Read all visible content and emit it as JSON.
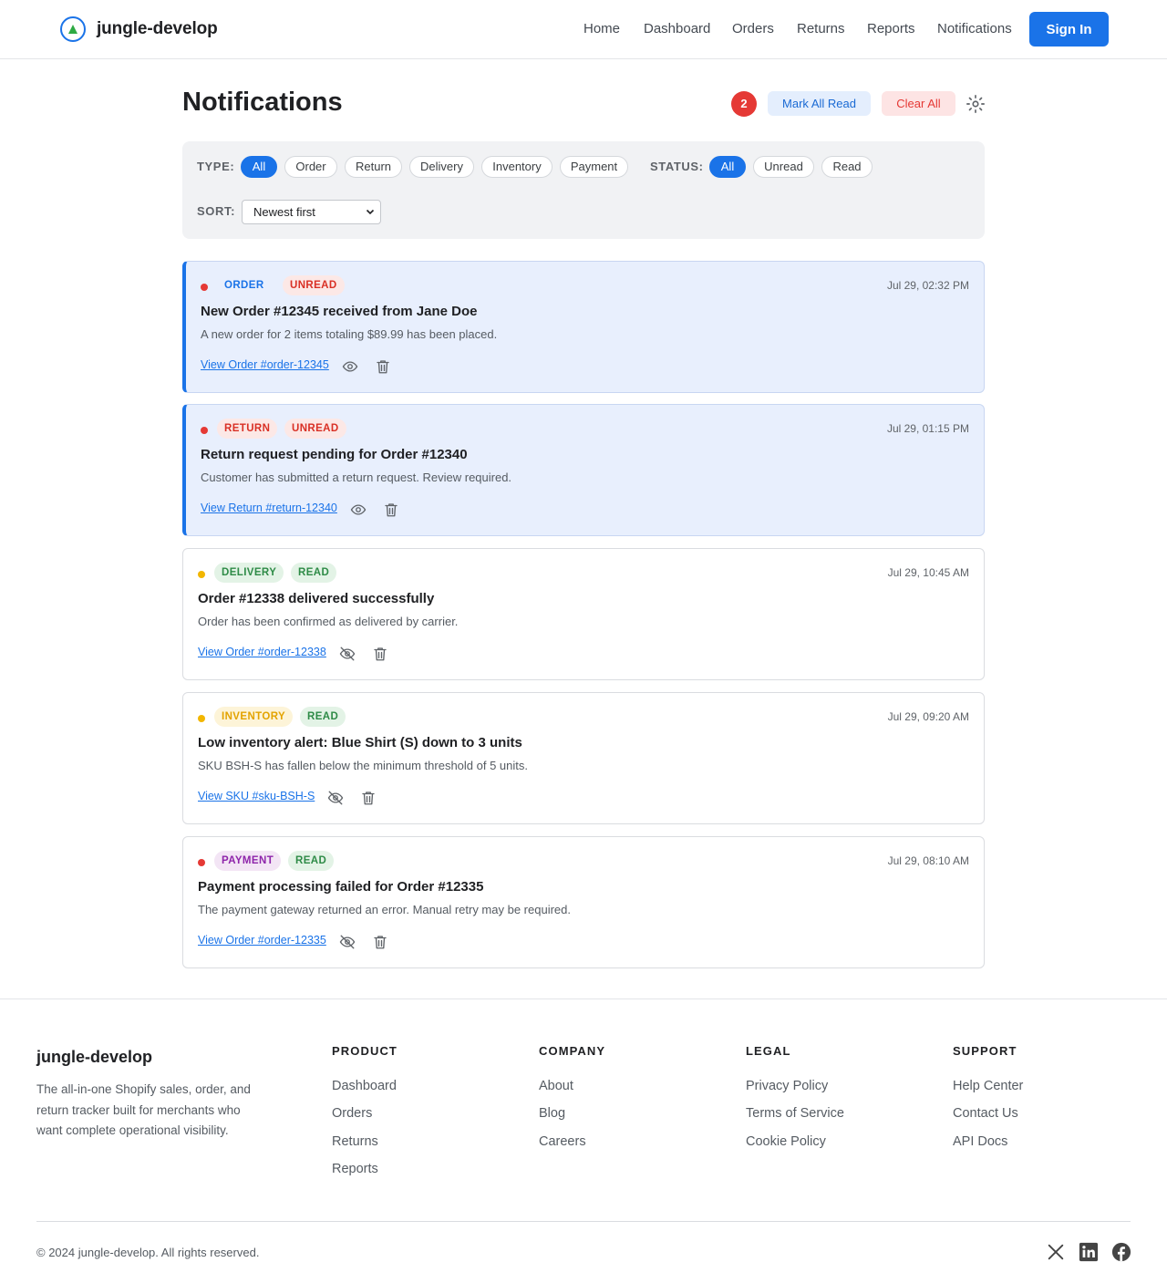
{
  "header": {
    "brand": "jungle-develop",
    "nav": [
      "Home",
      "Dashboard",
      "Orders",
      "Returns",
      "Reports",
      "Notifications"
    ],
    "signin_label": "Sign In"
  },
  "page": {
    "title": "Notifications",
    "unread_count": "2",
    "mark_all_label": "Mark All Read",
    "clear_all_label": "Clear All"
  },
  "filters": {
    "type_label": "TYPE:",
    "type_options": [
      "All",
      "Order",
      "Return",
      "Delivery",
      "Inventory",
      "Payment"
    ],
    "type_selected": "All",
    "status_label": "STATUS:",
    "status_options": [
      "All",
      "Unread",
      "Read"
    ],
    "status_selected": "All",
    "sort_label": "SORT:",
    "sort_value": "Newest first"
  },
  "notifications": [
    {
      "type": "ORDER",
      "status": "UNREAD",
      "time": "Jul 29, 02:32 PM",
      "title": "New Order #12345 received from Jane Doe",
      "description": "A new order for 2 items totaling $89.99 has been placed.",
      "link": "View Order #order-12345",
      "dot_color": "#e53935",
      "type_color": "#1a73e8",
      "type_bg": "transparent"
    },
    {
      "type": "RETURN",
      "status": "UNREAD",
      "time": "Jul 29, 01:15 PM",
      "title": "Return request pending for Order #12340",
      "description": "Customer has submitted a return request. Review required.",
      "link": "View Return #return-12340",
      "dot_color": "#e53935",
      "type_color": "#d93025",
      "type_bg": "#fce8e6"
    },
    {
      "type": "DELIVERY",
      "status": "READ",
      "time": "Jul 29, 10:45 AM",
      "title": "Order #12338 delivered successfully",
      "description": "Order has been confirmed as delivered by carrier.",
      "link": "View Order #order-12338",
      "dot_color": "#f2b600",
      "type_color": "#2e8b47",
      "type_bg": "#e3f3e6"
    },
    {
      "type": "INVENTORY",
      "status": "READ",
      "time": "Jul 29, 09:20 AM",
      "title": "Low inventory alert: Blue Shirt (S) down to 3 units",
      "description": "SKU BSH-S has fallen below the minimum threshold of 5 units.",
      "link": "View SKU #sku-BSH-S",
      "dot_color": "#f2b600",
      "type_color": "#e3a300",
      "type_bg": "#fdf4d8"
    },
    {
      "type": "PAYMENT",
      "status": "READ",
      "time": "Jul 29, 08:10 AM",
      "title": "Payment processing failed for Order #12335",
      "description": "The payment gateway returned an error. Manual retry may be required.",
      "link": "View Order #order-12335",
      "dot_color": "#e53935",
      "type_color": "#8e24aa",
      "type_bg": "#f3e5f5"
    }
  ],
  "footer": {
    "brand": "jungle-develop",
    "description": "The all-in-one Shopify sales, order, and return tracker built for merchants who want complete operational visibility.",
    "columns": [
      {
        "heading": "PRODUCT",
        "links": [
          "Dashboard",
          "Orders",
          "Returns",
          "Reports"
        ]
      },
      {
        "heading": "COMPANY",
        "links": [
          "About",
          "Blog",
          "Careers"
        ]
      },
      {
        "heading": "LEGAL",
        "links": [
          "Privacy Policy",
          "Terms of Service",
          "Cookie Policy"
        ]
      },
      {
        "heading": "SUPPORT",
        "links": [
          "Help Center",
          "Contact Us",
          "API Docs"
        ]
      }
    ],
    "copyright": "© 2024 jungle-develop. All rights reserved.",
    "social_icons": [
      "x-icon",
      "linkedin-icon",
      "facebook-icon"
    ]
  },
  "colors": {
    "accent": "#1a73e8",
    "danger": "#e53935",
    "unread_bg": "#e8effd",
    "read_badge_bg": "#e3f3e6",
    "read_badge_text": "#2e8b47",
    "unread_badge_bg": "#fce8e6",
    "unread_badge_text": "#d93025"
  }
}
